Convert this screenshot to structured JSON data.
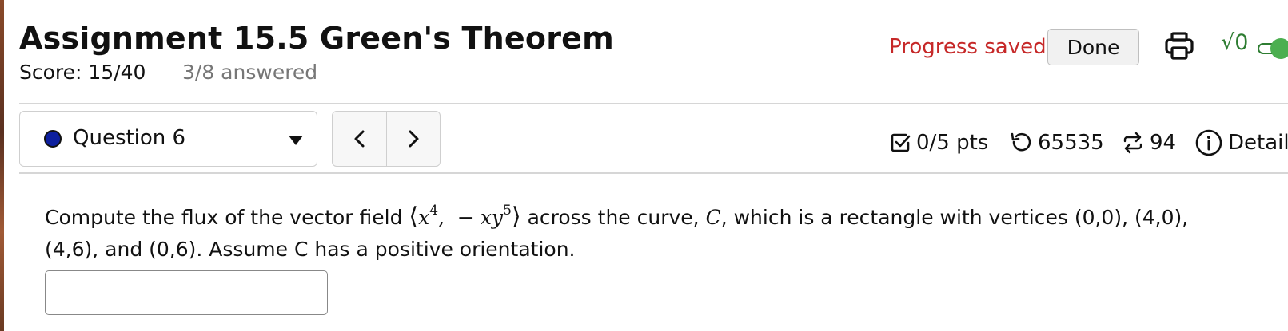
{
  "header": {
    "title": "Assignment 15.5 Green's Theorem",
    "score": "Score: 15/40",
    "answered": "3/8 answered",
    "progress_status": "Progress saved",
    "done_label": "Done",
    "sqrt_toggle_label": "√0"
  },
  "question_nav": {
    "selected": "Question 6",
    "prev_glyph": "‹",
    "next_glyph": "›"
  },
  "meta": {
    "points": "0/5 pts",
    "attempts": "65535",
    "versions": "94",
    "details": "Details"
  },
  "question": {
    "text_before": "Compute the flux of the vector field",
    "field_x": "x",
    "field_x_exp": "4",
    "field_y_sign": "−",
    "field_y": "xy",
    "field_y_exp": "5",
    "text_middle": "across the curve,",
    "curve_symbol": "C",
    "text_after": ", which is a rectangle with vertices (0,0), (4,0), (4,6), and (0,6). Assume C has a positive orientation."
  },
  "answer": {
    "value": "",
    "placeholder": ""
  },
  "colors": {
    "progress_red": "#c62828",
    "dot_blue": "#0d1f9e",
    "toggle_green": "#4caf50"
  }
}
